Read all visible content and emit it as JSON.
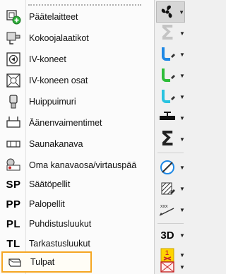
{
  "menu": {
    "items": [
      {
        "label": "Päätelaitteet",
        "icon": "terminal-device-icon"
      },
      {
        "label": "Kokoojalaatikot",
        "icon": "collector-box-icon"
      },
      {
        "label": "IV-koneet",
        "icon": "ventilation-unit-icon"
      },
      {
        "label": "IV-koneen osat",
        "icon": "ventilation-unit-part-icon"
      },
      {
        "label": "Huippuimuri",
        "icon": "roof-fan-icon"
      },
      {
        "label": "Äänenvaimentimet",
        "icon": "silencer-icon"
      },
      {
        "label": "Saunakanava",
        "icon": "sauna-duct-icon"
      },
      {
        "label": "Oma kanavaosa/virtauspää",
        "icon": "custom-duct-part-icon"
      },
      {
        "label": "Säätöpellit",
        "icon_text": "SP"
      },
      {
        "label": "Palopellit",
        "icon_text": "PP"
      },
      {
        "label": "Puhdistusluukut",
        "icon_text": "PL"
      },
      {
        "label": "Tarkastusluukut",
        "icon_text": "TL"
      },
      {
        "label": "Tulpat",
        "icon": "plug-icon",
        "selected": true
      }
    ]
  },
  "toolbar": {
    "buttons": [
      {
        "name": "fan-icon",
        "has_dropdown": true,
        "active": true
      },
      {
        "name": "sum-icon",
        "has_dropdown": true,
        "disabled": true
      },
      {
        "name": "blue-pipe-icon",
        "has_dropdown": true
      },
      {
        "name": "green-pipe-icon",
        "has_dropdown": true
      },
      {
        "name": "cyan-pipe-icon",
        "has_dropdown": true
      },
      {
        "name": "valve-icon",
        "has_dropdown": true
      },
      {
        "name": "sum-icon",
        "has_dropdown": true
      },
      {
        "name": "damper-icon",
        "has_dropdown": true
      },
      {
        "name": "hatch-icon",
        "has_dropdown": true
      },
      {
        "name": "dimension-icon",
        "has_dropdown": true,
        "label": "xxx"
      },
      {
        "name": "3d-icon",
        "has_dropdown": true,
        "label": "3D"
      },
      {
        "name": "warning-number-icon",
        "has_dropdown": true,
        "label": "1"
      },
      {
        "name": "red-box-icon",
        "has_dropdown": true
      }
    ]
  },
  "colors": {
    "selection_border": "#f5a623",
    "blue": "#1e88e5",
    "green": "#2ebd3a",
    "cyan": "#29c3e0"
  }
}
